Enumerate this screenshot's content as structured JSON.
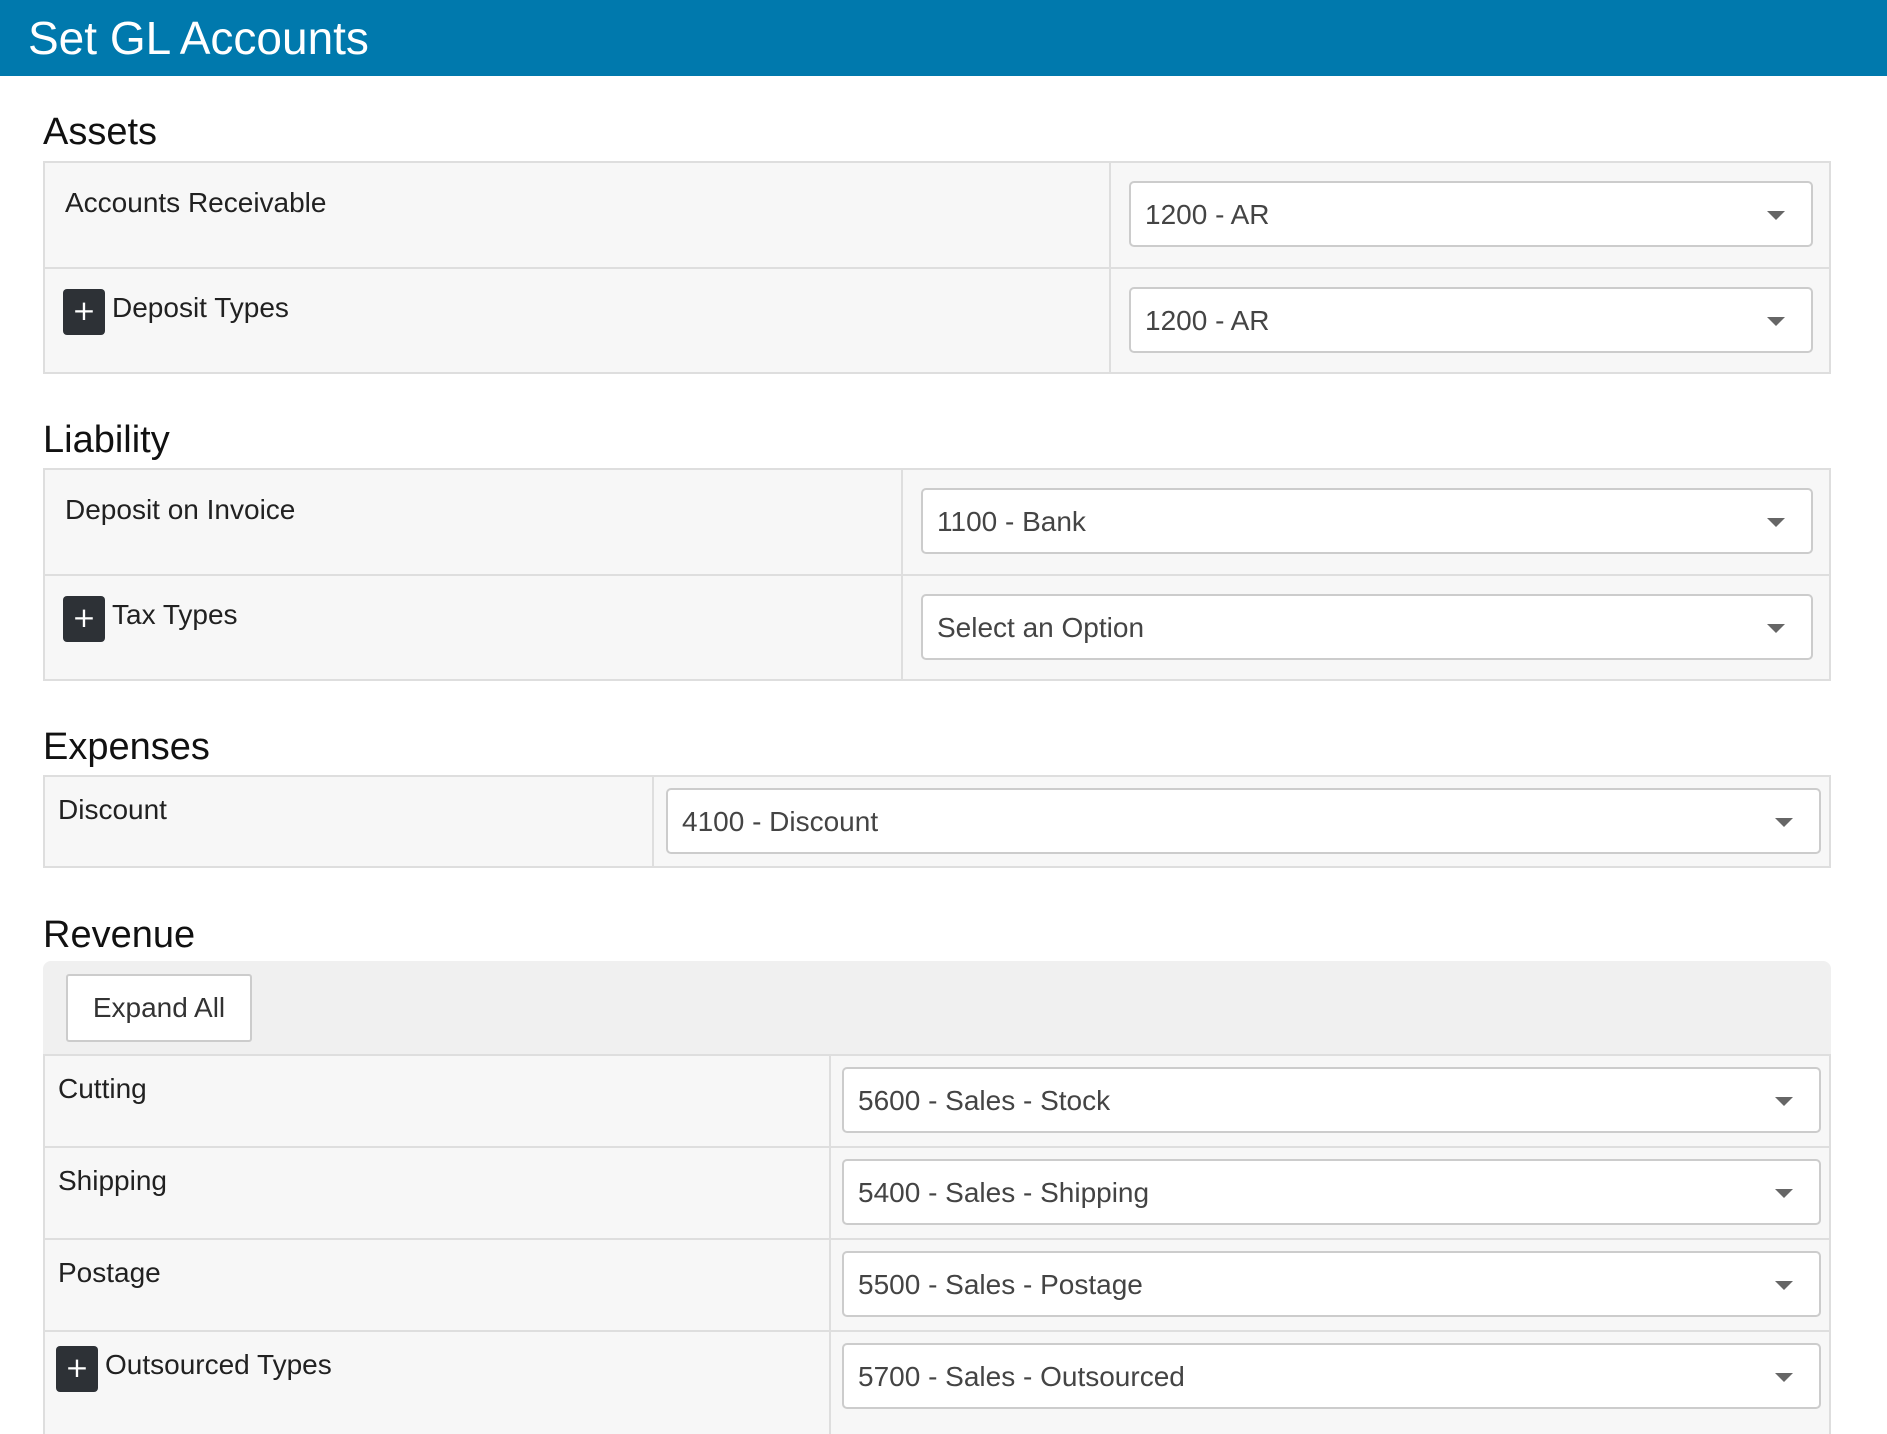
{
  "header": {
    "title": "Set GL Accounts"
  },
  "sections": {
    "assets": {
      "title": "Assets",
      "rows": [
        {
          "label": "Accounts Receivable",
          "value": "1200 - AR"
        },
        {
          "label": "Deposit Types",
          "value": "1200 - AR",
          "expand": "+"
        }
      ]
    },
    "liability": {
      "title": "Liability",
      "rows": [
        {
          "label": "Deposit on Invoice",
          "value": "1100 - Bank"
        },
        {
          "label": "Tax Types",
          "value": "Select an Option",
          "expand": "+"
        }
      ]
    },
    "expenses": {
      "title": "Expenses",
      "rows": [
        {
          "label": "Discount",
          "value": "4100 - Discount"
        }
      ]
    },
    "revenue": {
      "title": "Revenue",
      "expand_all_label": "Expand All",
      "rows": [
        {
          "label": "Cutting",
          "value": "5600 - Sales - Stock"
        },
        {
          "label": "Shipping",
          "value": "5400 - Sales - Shipping"
        },
        {
          "label": "Postage",
          "value": "5500 - Sales - Postage"
        },
        {
          "label": "Outsourced Types",
          "value": "5700 - Sales - Outsourced",
          "expand": "+"
        }
      ]
    }
  },
  "icons": {
    "dropdown": "chevron-down-icon",
    "expand": "plus-icon"
  },
  "colors": {
    "header_bg": "#0079ad",
    "header_text": "#ffffff",
    "expand_btn_bg": "#2d3136"
  }
}
